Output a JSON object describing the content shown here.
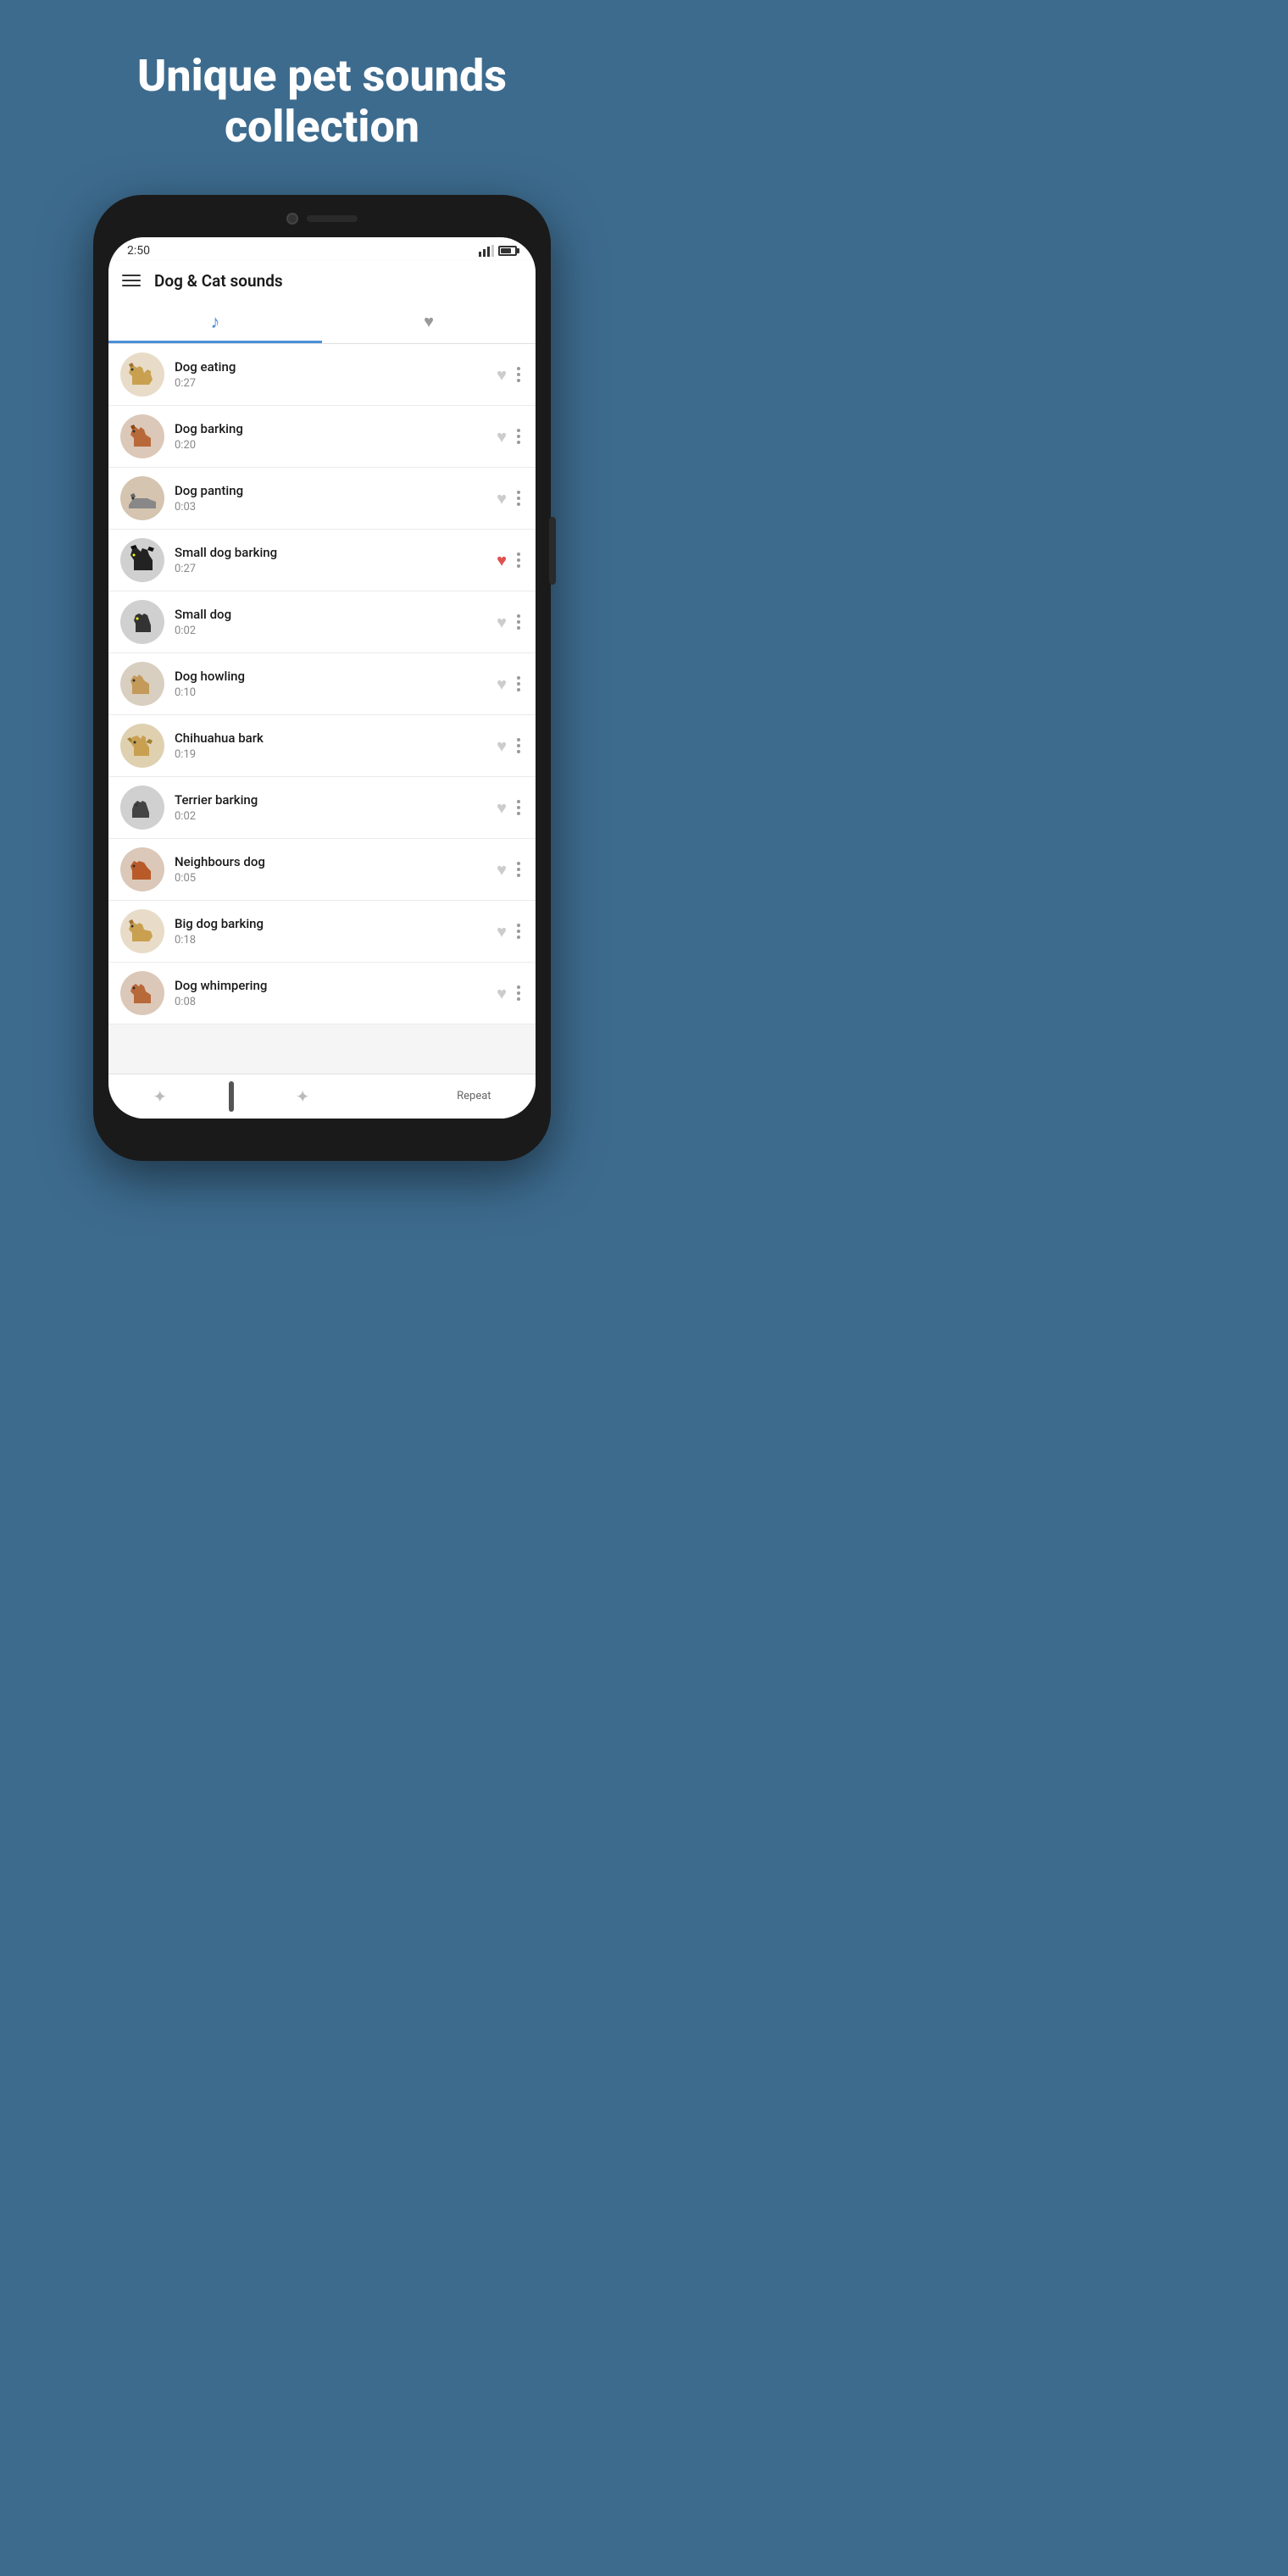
{
  "hero": {
    "title": "Unique pet sounds collection"
  },
  "status_bar": {
    "time": "2:50"
  },
  "app_header": {
    "title": "Dog & Cat sounds"
  },
  "tabs": [
    {
      "id": "sounds",
      "label": "sounds",
      "active": true
    },
    {
      "id": "favorites",
      "label": "favorites",
      "active": false
    }
  ],
  "sounds": [
    {
      "name": "Dog eating",
      "duration": "0:27",
      "favorite": false,
      "color": "#d4a96a",
      "type": "german_shepherd"
    },
    {
      "name": "Dog barking",
      "duration": "0:20",
      "favorite": false,
      "color": "#b8693a",
      "type": "boxer"
    },
    {
      "name": "Dog panting",
      "duration": "0:03",
      "favorite": false,
      "color": "#888",
      "type": "dachshund"
    },
    {
      "name": "Small dog barking",
      "duration": "0:27",
      "favorite": true,
      "color": "#222",
      "type": "doberman_black"
    },
    {
      "name": "Small dog",
      "duration": "0:02",
      "favorite": false,
      "color": "#333",
      "type": "doberman_small"
    },
    {
      "name": "Dog howling",
      "duration": "0:10",
      "favorite": false,
      "color": "#c49a5a",
      "type": "mixed"
    },
    {
      "name": "Chihuahua bark",
      "duration": "0:19",
      "favorite": false,
      "color": "#c8a050",
      "type": "chihuahua"
    },
    {
      "name": "Terrier barking",
      "duration": "0:02",
      "favorite": false,
      "color": "#333",
      "type": "terrier"
    },
    {
      "name": "Neighbours dog",
      "duration": "0:05",
      "favorite": false,
      "color": "#b85a2a",
      "type": "red_dog"
    },
    {
      "name": "Big dog barking",
      "duration": "0:18",
      "favorite": false,
      "color": "#c8a050",
      "type": "german_shepherd2"
    },
    {
      "name": "Dog whimpering",
      "duration": "0:08",
      "favorite": false,
      "color": "#b8693a",
      "type": "boxer2"
    }
  ],
  "bottom_nav": {
    "repeat_label": "Repeat"
  }
}
